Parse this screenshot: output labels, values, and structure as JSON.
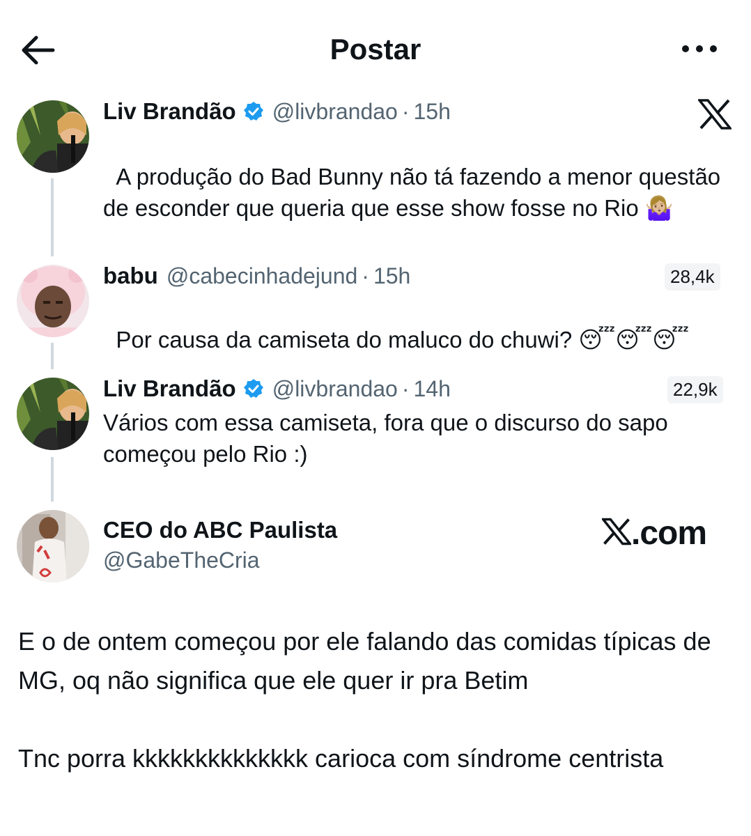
{
  "header": {
    "title": "Postar"
  },
  "tweets": [
    {
      "name": "Liv Brandão",
      "handle": "@livbrandao",
      "separator": "·",
      "time": "15h",
      "text": "A produção do Bad Bunny não tá fazendo a menor questão de esconder que queria que esse show fosse no Rio",
      "emoji": "🤷🏼‍♀️"
    },
    {
      "name": "babu",
      "handle": "@cabecinhadejund",
      "separator": "·",
      "time": "15h",
      "count": "28,4k",
      "text": "Por causa da camiseta do maluco do chuwi?",
      "emoji": "😴😴😴"
    },
    {
      "name": "Liv Brandão",
      "handle": "@livbrandao",
      "separator": "·",
      "time": "14h",
      "count": "22,9k",
      "text": "Vários com essa camiseta, fora que o discurso do sapo começou pelo Rio :)"
    }
  ],
  "main_post": {
    "name": "CEO do ABC Paulista",
    "handle": "@GabeTheCria",
    "paragraph1": "E o de ontem começou por ele falando das comidas típicas de MG, oq não significa que ele quer ir pra Betim",
    "paragraph2": "Tnc porra kkkkkkkkkkkkkk carioca com síndrome centrista"
  },
  "watermark": {
    "brand_suffix": ".com"
  },
  "colors": {
    "text": "#0f1419",
    "secondary": "#536471",
    "verified": "#1d9bf0",
    "thread_line": "#cfd9de"
  },
  "icons": [
    "back-arrow-icon",
    "more-icon",
    "verified-badge-icon",
    "x-logo-icon"
  ]
}
